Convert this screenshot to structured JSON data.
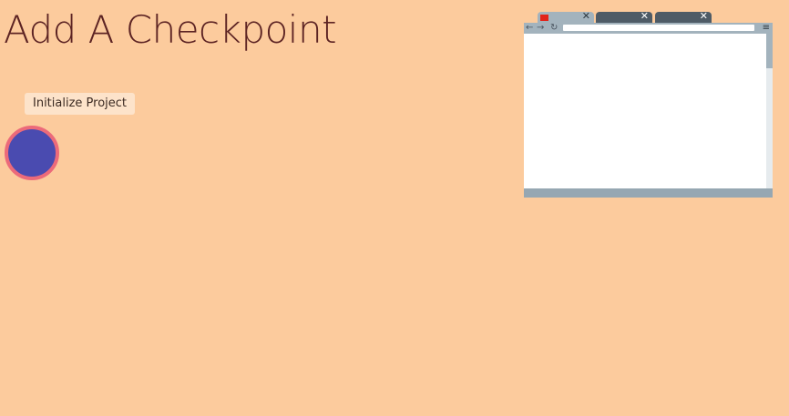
{
  "header": {
    "title": "Add A Checkpoint"
  },
  "controls": {
    "init_button_label": "Initialize Project"
  },
  "browser": {
    "tabs": [
      {
        "close_label": "✕",
        "active": true,
        "favicon": "red-square-favicon"
      },
      {
        "close_label": "✕",
        "active": false
      },
      {
        "close_label": "✕",
        "active": false
      }
    ],
    "nav": {
      "back": "←",
      "forward": "→",
      "reload": "↻",
      "menu": "≡"
    }
  },
  "colors": {
    "background": "#FCCB9D",
    "title": "#5C2323",
    "button_bg": "#FDE3CA",
    "circle_fill": "#4A4BB0",
    "circle_border": "#EC6A7A",
    "browser_chrome": "#A3B3BD",
    "browser_tab_dark": "#4E5B66",
    "favicon": "#E2231A"
  }
}
